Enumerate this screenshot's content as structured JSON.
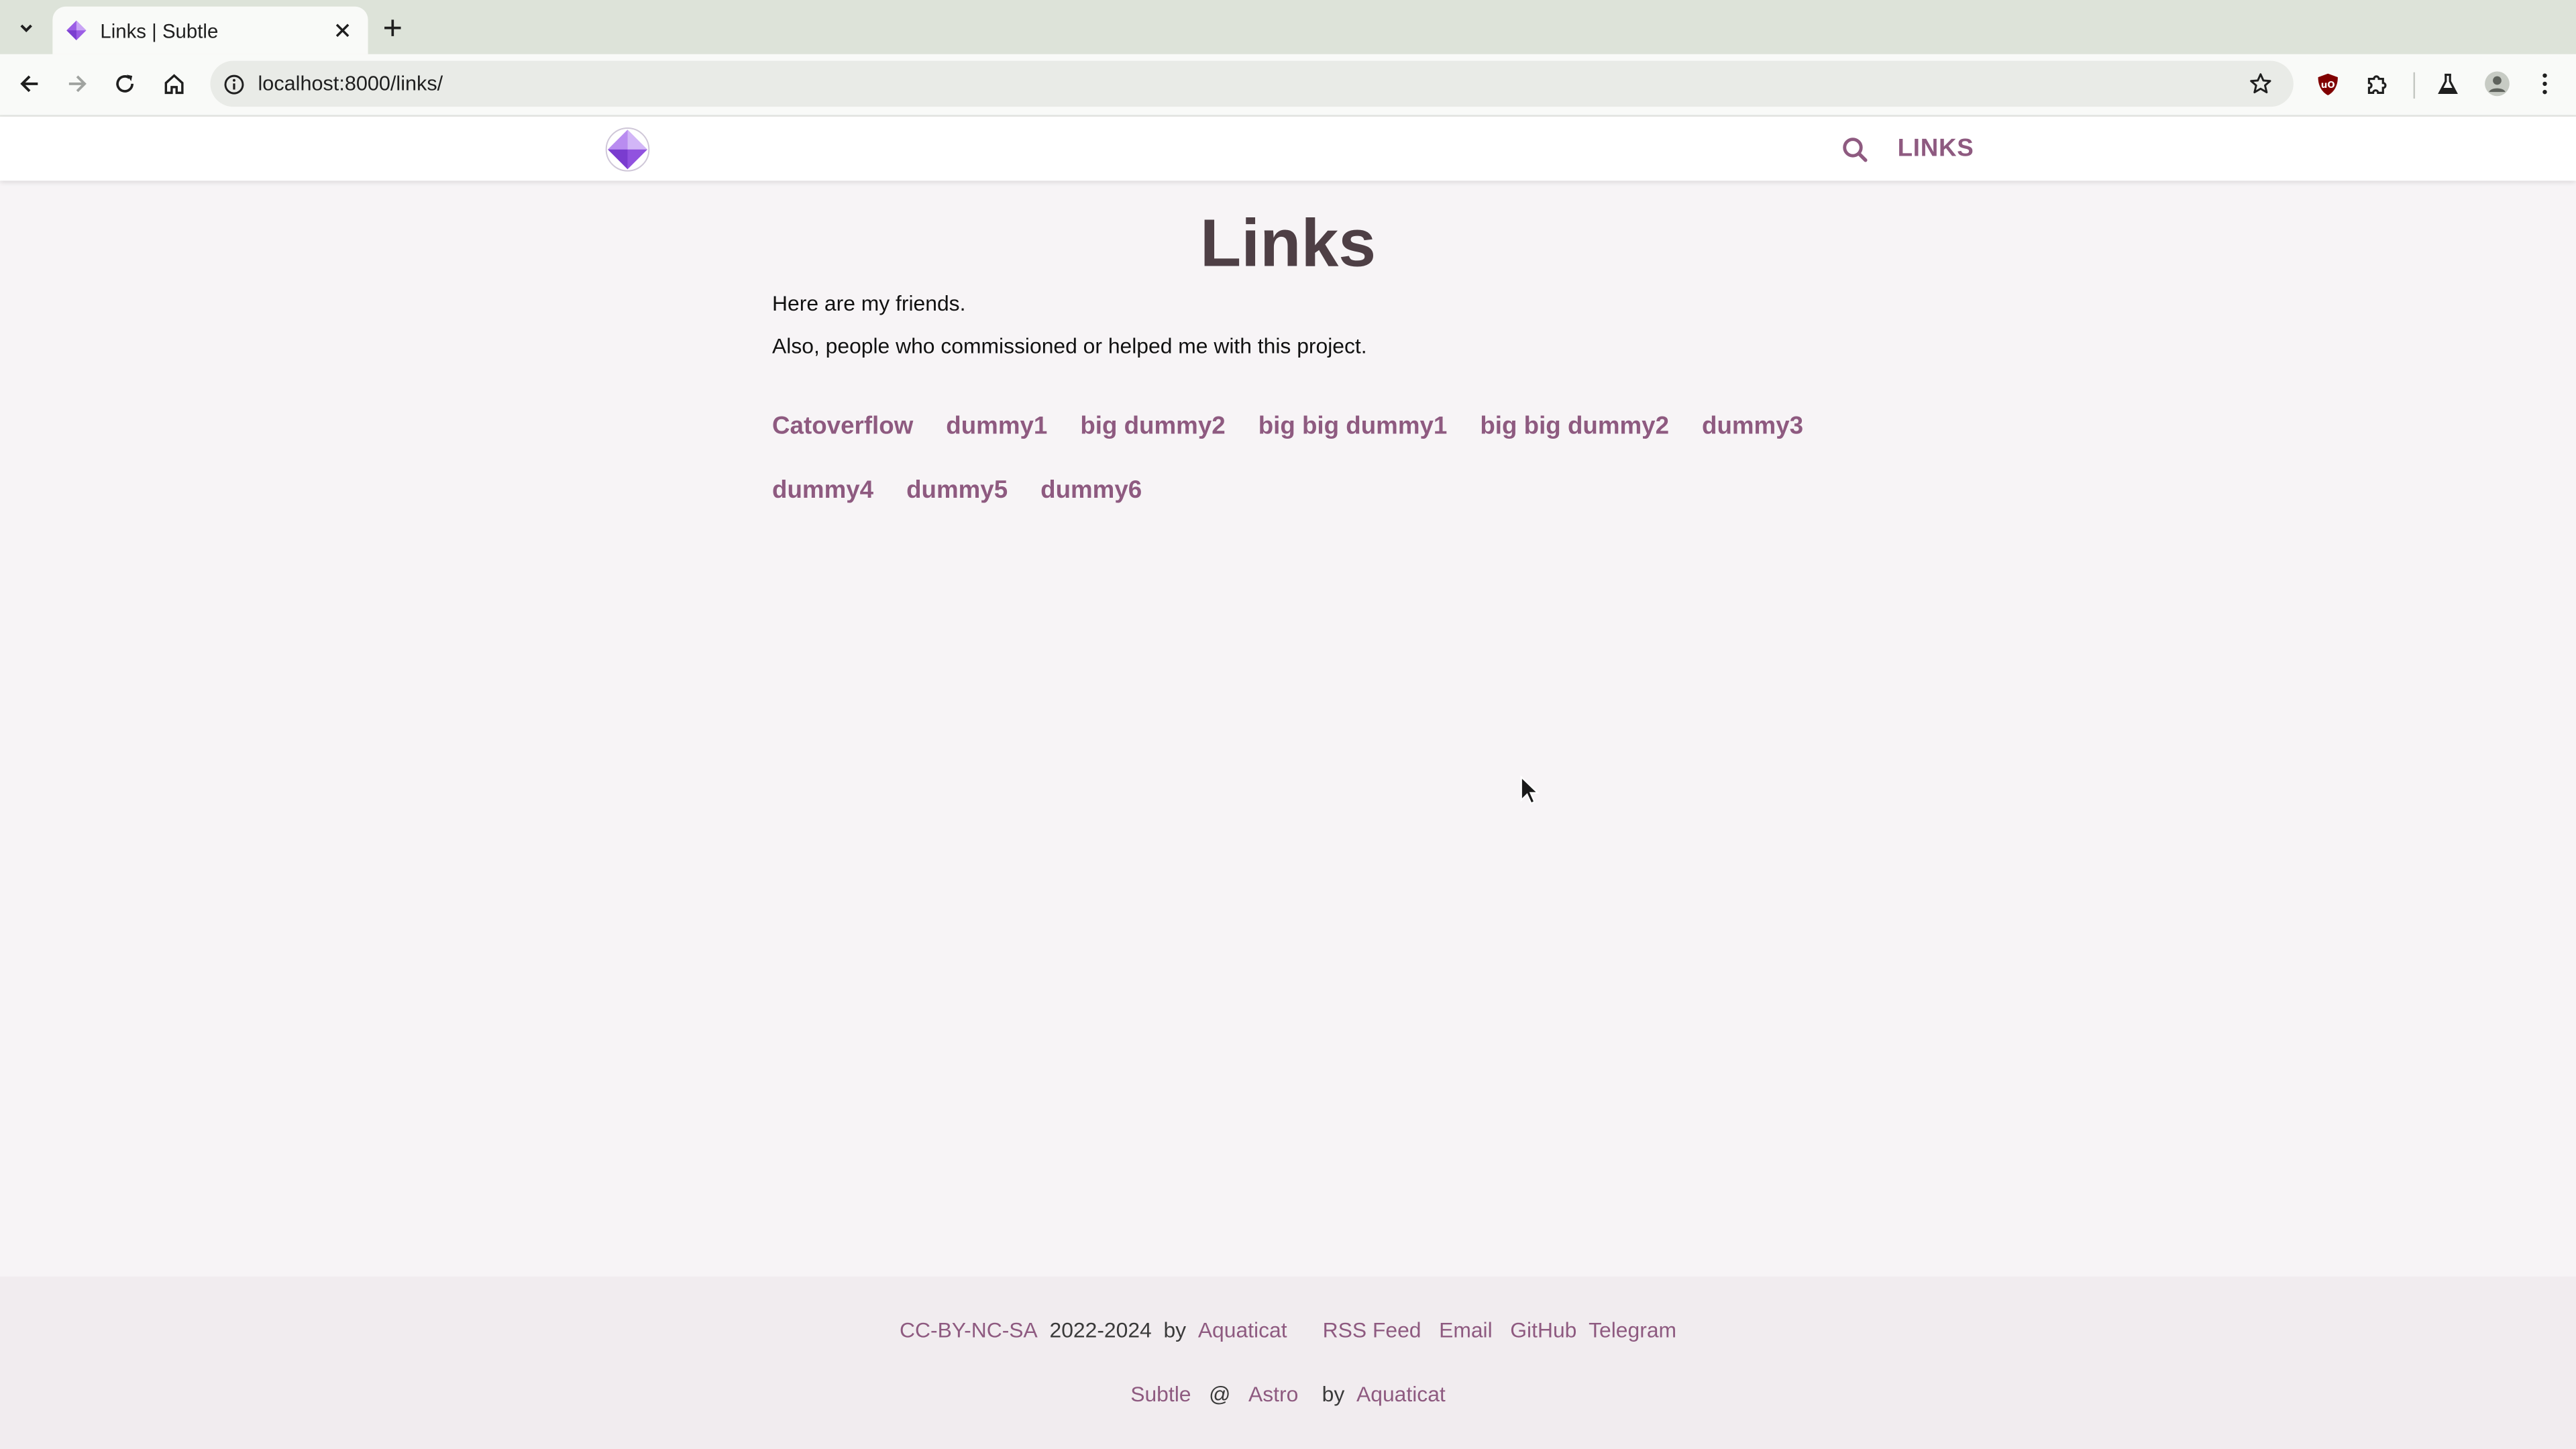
{
  "browser": {
    "tab": {
      "title": "Links | Subtle"
    },
    "url": "localhost:8000/links/"
  },
  "site": {
    "nav": {
      "links_label": "LINKS"
    }
  },
  "page": {
    "title": "Links",
    "intro": [
      "Here are my friends.",
      "Also, people who commissioned or helped me with this project."
    ],
    "friends": [
      "Catoverflow",
      "dummy1",
      "big dummy2",
      "big big dummy1",
      "big big dummy2",
      "dummy3",
      "dummy4",
      "dummy5",
      "dummy6"
    ]
  },
  "footer": {
    "license": "CC-BY-NC-SA",
    "years": "2022-2024",
    "by": "by",
    "author": "Aquaticat",
    "rss": "RSS Feed",
    "email": "Email",
    "github": "GitHub",
    "telegram": "Telegram",
    "theme": "Subtle",
    "at": "@",
    "framework": "Astro",
    "by2": "by",
    "theme_author": "Aquaticat"
  },
  "colors": {
    "accent": "#8e5a80",
    "title": "#4e3f45",
    "background": "#f7f4f6",
    "footer_background": "#f1ecef"
  }
}
